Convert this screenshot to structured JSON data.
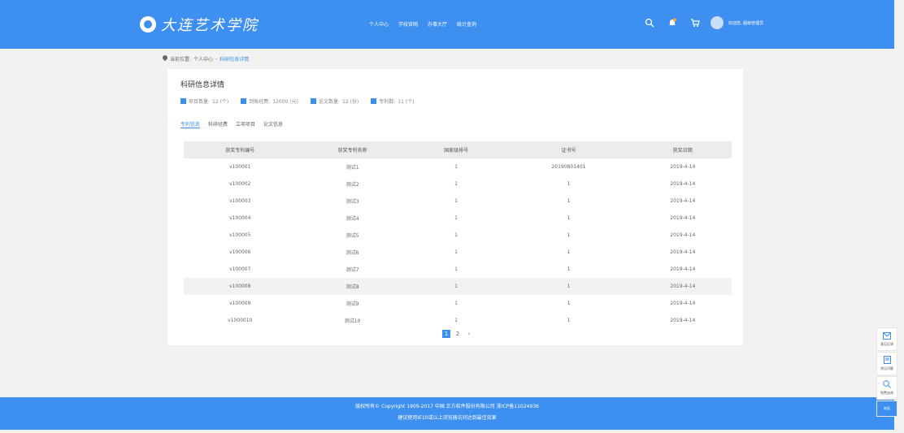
{
  "header": {
    "logo_text": "大连艺术学院",
    "nav": [
      "个人中心",
      "学校官网",
      "办事大厅",
      "统计查询"
    ],
    "user": "欢迎您, 超级管理员"
  },
  "breadcrumb": {
    "prefix": "当前位置:",
    "home": "个人中心",
    "separator": "-",
    "current": "科研信息详情"
  },
  "card": {
    "title": "科研信息详情",
    "stats": [
      {
        "label": "项目数量:",
        "value": "12 (个)"
      },
      {
        "label": "到账经费:",
        "value": "12000 (元)"
      },
      {
        "label": "论文数量:",
        "value": "12 (份)"
      },
      {
        "label": "专利数:",
        "value": "11 (个)"
      }
    ],
    "tabs": [
      "专利信息",
      "科研经费",
      "立项项目",
      "论文信息"
    ],
    "active_tab": 0
  },
  "table": {
    "headers": [
      "获奖专利编号",
      "获奖专利名称",
      "国家级排号",
      "证书号",
      "获奖日期"
    ],
    "rows": [
      [
        "v100001",
        "测试1",
        "1",
        "20190801401",
        "2019-4-14"
      ],
      [
        "v100002",
        "测试2",
        "1",
        "1",
        "2019-4-14"
      ],
      [
        "v100003",
        "测试3",
        "1",
        "1",
        "2019-4-14"
      ],
      [
        "v100004",
        "测试4",
        "1",
        "1",
        "2019-4-14"
      ],
      [
        "v100005",
        "测试5",
        "1",
        "1",
        "2019-4-14"
      ],
      [
        "v100006",
        "测试6",
        "1",
        "1",
        "2019-4-14"
      ],
      [
        "v100007",
        "测试7",
        "1",
        "1",
        "2019-4-14"
      ],
      [
        "v100008",
        "测试8",
        "1",
        "1",
        "2019-4-14"
      ],
      [
        "v100009",
        "测试9",
        "1",
        "1",
        "2019-4-14"
      ],
      [
        "v1000010",
        "测试10",
        "1",
        "1",
        "2019-4-14"
      ]
    ],
    "highlighted_row": 7
  },
  "pagination": {
    "pages": [
      "1",
      "2"
    ],
    "current": "1",
    "next": "›"
  },
  "footer": {
    "line1": "版权所有© Copyright 1909-2017 中国 正方软件股份有限公司 浙ICP备11024936",
    "line2": "建议使用IE10或以上浏览器访问达到最佳效果"
  },
  "sidebar": {
    "items": [
      "意见反馈",
      "常见问题",
      "免费咨询"
    ],
    "collapse": "收起"
  },
  "colors": {
    "brand": "#3d8ff0",
    "background": "#f2f2f2"
  }
}
